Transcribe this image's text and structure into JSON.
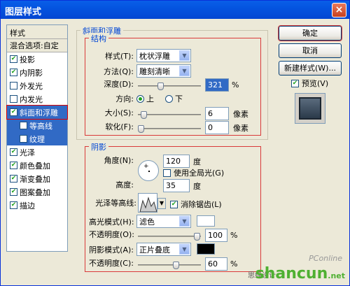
{
  "window": {
    "title": "图层样式",
    "close": "×"
  },
  "left_panel": {
    "title": "样式",
    "blend": "混合选项:自定",
    "items": [
      {
        "label": "投影",
        "checked": true
      },
      {
        "label": "内阴影",
        "checked": true
      },
      {
        "label": "外发光",
        "checked": false
      },
      {
        "label": "内发光",
        "checked": false
      },
      {
        "label": "斜面和浮雕",
        "checked": true
      },
      {
        "label": "等高线",
        "checked": false
      },
      {
        "label": "纹理",
        "checked": false
      },
      {
        "label": "光泽",
        "checked": true
      },
      {
        "label": "颜色叠加",
        "checked": true
      },
      {
        "label": "渐变叠加",
        "checked": true
      },
      {
        "label": "图案叠加",
        "checked": true
      },
      {
        "label": "描边",
        "checked": true
      }
    ]
  },
  "bevel": {
    "group_title": "斜面和浮雕",
    "structure_title": "结构",
    "style_label": "样式(T):",
    "style_value": "枕状浮雕",
    "technique_label": "方法(Q):",
    "technique_value": "雕刻清晰",
    "depth_label": "深度(D):",
    "depth_value": "321",
    "depth_unit": "%",
    "direction_label": "方向:",
    "dir_up": "上",
    "dir_down": "下",
    "size_label": "大小(S):",
    "size_value": "6",
    "size_unit": "像素",
    "soften_label": "软化(F):",
    "soften_value": "0",
    "soften_unit": "像素"
  },
  "shading": {
    "title": "阴影",
    "angle_label": "角度(N):",
    "angle_value": "120",
    "angle_unit": "度",
    "global_light": "使用全局光(G)",
    "altitude_label": "高度:",
    "altitude_value": "35",
    "altitude_unit": "度",
    "gloss_label": "光泽等高线:",
    "antialias": "消除锯齿(L)",
    "highlight_label": "高光模式(H):",
    "highlight_value": "滤色",
    "opacity1_label": "不透明度(O):",
    "opacity1_value": "100",
    "opacity_unit": "%",
    "shadow_label": "阴影模式(A):",
    "shadow_value": "正片叠底",
    "opacity2_label": "不透明度(C):",
    "opacity2_value": "60"
  },
  "buttons": {
    "ok": "确定",
    "cancel": "取消",
    "new_style": "新建样式(W)...",
    "preview": "预览(V)"
  },
  "watermark": {
    "site": "shancun",
    "domain": ".net",
    "designer": "思缘设计",
    "pconline": "PConline"
  }
}
